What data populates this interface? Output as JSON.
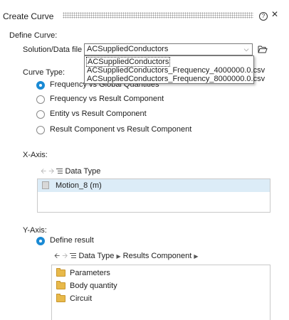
{
  "header": {
    "title": "Create Curve",
    "help_glyph": "?",
    "close_glyph": "✕"
  },
  "define_curve": {
    "section_label": "Define Curve:",
    "file_label": "Solution/Data file",
    "selected_file": "ACSuppliedConductors",
    "dropdown_options": [
      "ACSuppliedConductors",
      "ACSuppliedConductors_Frequency_4000000.0.csv",
      "ACSuppliedConductors_Frequency_8000000.0.csv"
    ]
  },
  "curve_type": {
    "label": "Curve Type:",
    "options": [
      {
        "label": "Frequency vs Global Quantities",
        "selected": true
      },
      {
        "label": "Frequency vs Result Component",
        "selected": false
      },
      {
        "label": "Entity vs Result Component",
        "selected": false
      },
      {
        "label": "Result Component vs Result Component",
        "selected": false
      }
    ]
  },
  "x_axis": {
    "label": "X-Axis:",
    "breadcrumb": "Data Type",
    "items": [
      "Motion_8 (m)"
    ]
  },
  "y_axis": {
    "label": "Y-Axis:",
    "define_result_label": "Define result",
    "breadcrumb": [
      "Data Type",
      "Results Component"
    ],
    "items": [
      "Parameters",
      "Body quantity",
      "Circuit"
    ]
  }
}
